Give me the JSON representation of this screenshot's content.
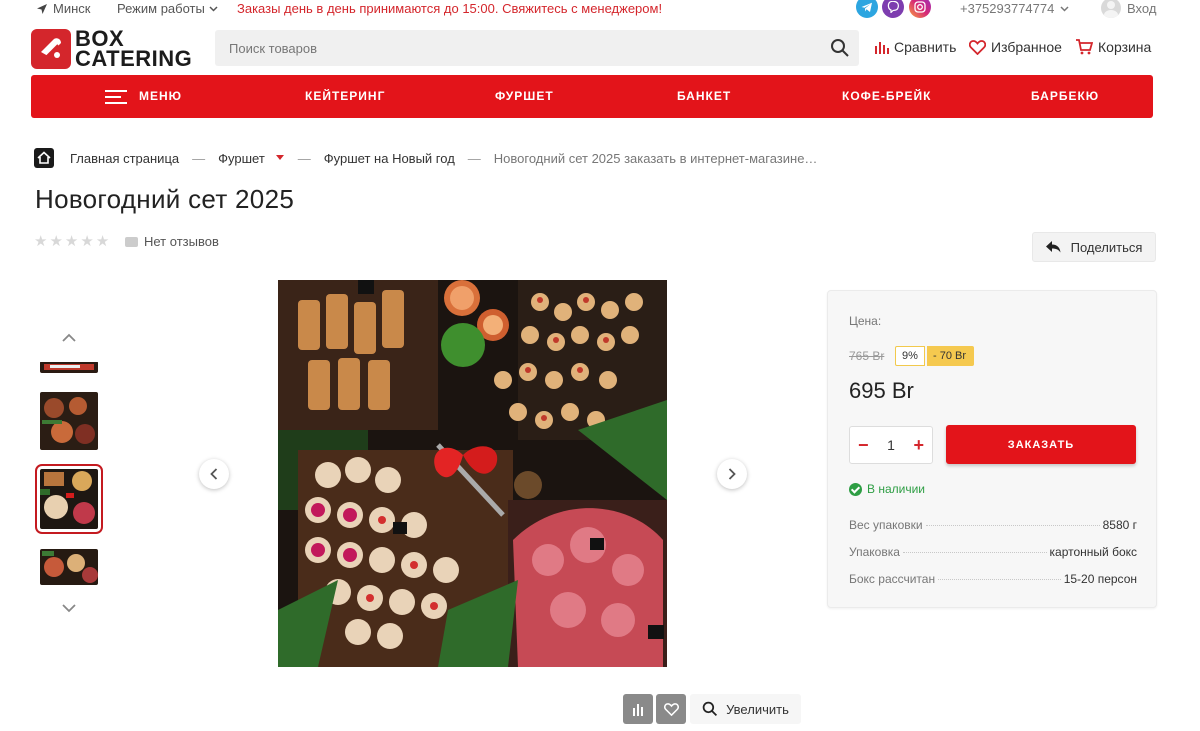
{
  "topbar": {
    "city": "Минск",
    "hours_label": "Режим работы",
    "promo": "Заказы день в день принимаются до 15:00. Свяжитесь с менеджером!",
    "phone": "+375293774774",
    "login": "Вход",
    "socials": [
      "telegram-icon",
      "viber-icon",
      "instagram-icon"
    ]
  },
  "header": {
    "logo_line1": "BOX",
    "logo_line2": "CATERING",
    "search_placeholder": "Поиск товаров",
    "compare": "Сравнить",
    "favorites": "Избранное",
    "cart": "Корзина"
  },
  "nav": {
    "menu": "МЕНЮ",
    "items": [
      "КЕЙТЕРИНГ",
      "ФУРШЕТ",
      "БАНКЕТ",
      "КОФЕ-БРЕЙК",
      "БАРБЕКЮ"
    ]
  },
  "breadcrumbs": {
    "home": "Главная страница",
    "level1": "Фуршет",
    "level2": "Фуршет на Новый год",
    "current": "Новогодний сет 2025 заказать в интернет-магазине…"
  },
  "product": {
    "title": "Новогодний сет 2025",
    "rating_stars": 0,
    "reviews": "Нет отзывов",
    "share": "Поделиться",
    "zoom": "Увеличить"
  },
  "buy": {
    "price_label": "Цена:",
    "old_price": "765 Br",
    "discount_pct": "9%",
    "discount_amount": "- 70 Br",
    "price": "695 Br",
    "quantity": "1",
    "order_button": "ЗАКАЗАТЬ",
    "stock": "В наличии",
    "props": [
      {
        "k": "Вес упаковки",
        "v": "8580 г"
      },
      {
        "k": "Упаковка",
        "v": "картонный бокс"
      },
      {
        "k": "Бокс рассчитан",
        "v": "15-20 персон"
      }
    ]
  },
  "colors": {
    "brand_red": "#e3141a",
    "in_stock": "#2e9e44",
    "discount_badge": "#f5c94f"
  }
}
